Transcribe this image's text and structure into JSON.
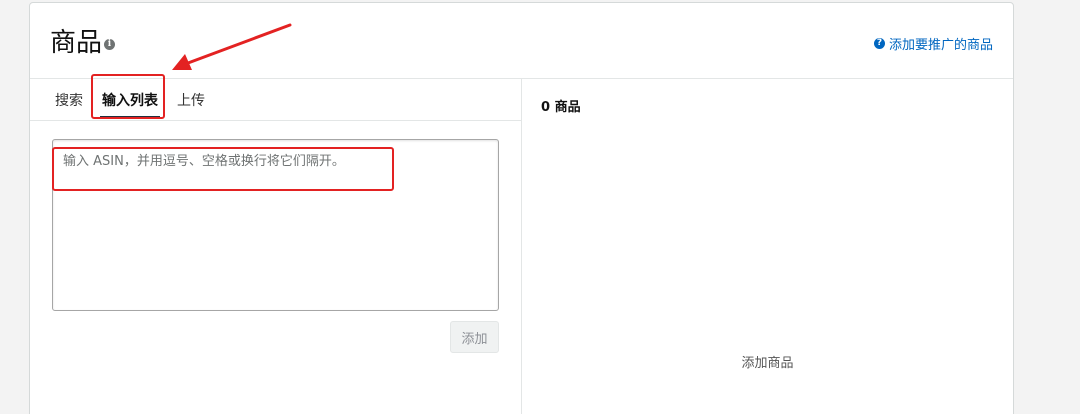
{
  "header": {
    "title": "商品",
    "info_icon": "info-icon",
    "help_link": "添加要推广的商品",
    "help_icon": "question-icon"
  },
  "tabs": [
    {
      "label": "搜索",
      "active": false
    },
    {
      "label": "输入列表",
      "active": true
    },
    {
      "label": "上传",
      "active": false
    }
  ],
  "input": {
    "placeholder": "输入 ASIN，并用逗号、空格或换行将它们隔开。",
    "value": ""
  },
  "add_button": "添加",
  "right_panel": {
    "count_label": "0 商品",
    "empty_text": "添加商品"
  },
  "colors": {
    "link": "#0066c0",
    "annotation": "#e32222",
    "tab_underline": "#232f3e"
  }
}
